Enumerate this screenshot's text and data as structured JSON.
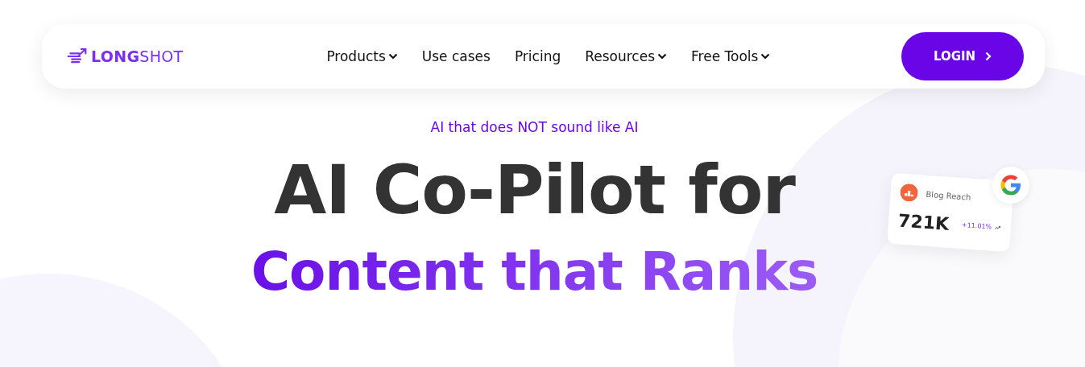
{
  "logo": {
    "text": "**LONG**SHOT"
  },
  "nav": [
    {
      "label": "Products",
      "dropdown": true
    },
    {
      "label": "Use cases",
      "dropdown": false
    },
    {
      "label": "Pricing",
      "dropdown": false
    },
    {
      "label": "Resources",
      "dropdown": true
    },
    {
      "label": "Free Tools",
      "dropdown": true
    }
  ],
  "login": {
    "label": "LOGIN"
  },
  "hero": {
    "tagline": "AI that does NOT sound like AI",
    "title_line_1": "AI Co-Pilot for",
    "title_line_2": "Content that Ranks"
  },
  "stat_card": {
    "label": "Blog Reach",
    "value": "721K",
    "change": "+11.01%"
  }
}
